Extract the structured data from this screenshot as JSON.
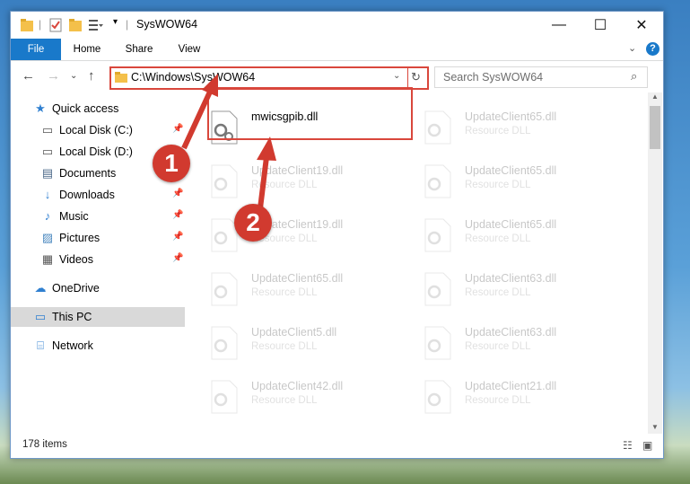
{
  "window": {
    "title": "SysWOW64"
  },
  "ribbon": {
    "tabs": [
      "File",
      "Home",
      "Share",
      "View"
    ]
  },
  "address": {
    "path": "C:\\Windows\\SysWOW64"
  },
  "search": {
    "placeholder": "Search SysWOW64"
  },
  "sidebar": {
    "items": [
      {
        "label": "Quick access",
        "icon": "star-icon"
      },
      {
        "label": "Local Disk (C:)",
        "icon": "drive-icon",
        "pinned": true
      },
      {
        "label": "Local Disk (D:)",
        "icon": "drive-icon"
      },
      {
        "label": "Documents",
        "icon": "documents-icon",
        "pinned": true
      },
      {
        "label": "Downloads",
        "icon": "downloads-icon",
        "pinned": true
      },
      {
        "label": "Music",
        "icon": "music-icon",
        "pinned": true
      },
      {
        "label": "Pictures",
        "icon": "pictures-icon",
        "pinned": true
      },
      {
        "label": "Videos",
        "icon": "videos-icon",
        "pinned": true
      },
      {
        "label": "OneDrive",
        "icon": "onedrive-icon"
      },
      {
        "label": "This PC",
        "icon": "pc-icon",
        "selected": true
      },
      {
        "label": "Network",
        "icon": "network-icon"
      }
    ]
  },
  "files": {
    "highlighted": {
      "name": "mwicsgpib.dll"
    },
    "left": [
      {
        "name": "UpdateClient19.dll",
        "type": "Resource DLL"
      },
      {
        "name": "UpdateClient19.dll",
        "type": "Resource DLL"
      },
      {
        "name": "UpdateClient65.dll",
        "type": "Resource DLL"
      },
      {
        "name": "UpdateClient5.dll",
        "type": "Resource DLL"
      },
      {
        "name": "UpdateClient42.dll",
        "type": "Resource DLL"
      }
    ],
    "right": [
      {
        "name": "UpdateClient65.dll",
        "type": "Resource DLL"
      },
      {
        "name": "UpdateClient65.dll",
        "type": "Resource DLL"
      },
      {
        "name": "UpdateClient65.dll",
        "type": "Resource DLL"
      },
      {
        "name": "UpdateClient63.dll",
        "type": "Resource DLL"
      },
      {
        "name": "UpdateClient63.dll",
        "type": "Resource DLL"
      },
      {
        "name": "UpdateClient21.dll",
        "type": "Resource DLL"
      }
    ]
  },
  "status": {
    "items": "178 items"
  },
  "annotations": {
    "step1": "1",
    "step2": "2"
  },
  "colors": {
    "accent": "#1979ca",
    "highlight": "#d9473c"
  }
}
